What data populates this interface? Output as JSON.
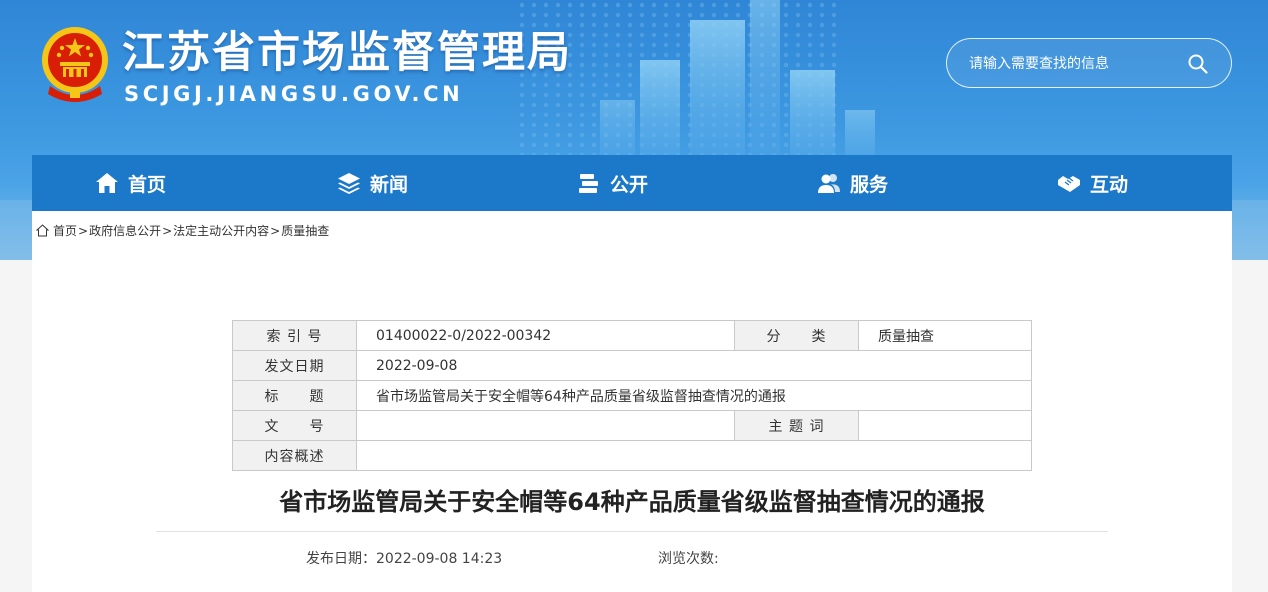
{
  "header": {
    "title": "江苏省市场监督管理局",
    "domain": "SCJGJ.JIANGSU.GOV.CN",
    "search_placeholder": "请输入需要查找的信息"
  },
  "nav": {
    "items": [
      {
        "label": "首页",
        "icon": "home-icon"
      },
      {
        "label": "新闻",
        "icon": "layers-icon"
      },
      {
        "label": "公开",
        "icon": "books-icon"
      },
      {
        "label": "服务",
        "icon": "people-icon"
      },
      {
        "label": "互动",
        "icon": "handshake-icon"
      }
    ]
  },
  "breadcrumb": {
    "items": [
      "首页",
      "政府信息公开",
      "法定主动公开内容",
      "质量抽查"
    ],
    "separator": ">"
  },
  "info": {
    "index_label": "索 引 号",
    "index_value": "01400022-0/2022-00342",
    "category_label": "分　　类",
    "category_value": "质量抽查",
    "date_label": "发文日期",
    "date_value": "2022-09-08",
    "title_label": "标　　题",
    "title_value": "省市场监管局关于安全帽等64种产品质量省级监督抽查情况的通报",
    "docno_label": "文　　号",
    "docno_value": "",
    "keywords_label": "主 题 词",
    "keywords_value": "",
    "summary_label": "内容概述",
    "summary_value": ""
  },
  "article": {
    "title": "省市场监管局关于安全帽等64种产品质量省级监督抽查情况的通报",
    "publish_label": "发布日期：",
    "publish_value": "2022-09-08 14:23",
    "views_label": "浏览次数:",
    "views_value": ""
  },
  "colors": {
    "header_blue": "#2f86d6",
    "nav_blue": "#1c79c9",
    "emblem_red": "#d81e06",
    "emblem_gold": "#f5c518"
  }
}
